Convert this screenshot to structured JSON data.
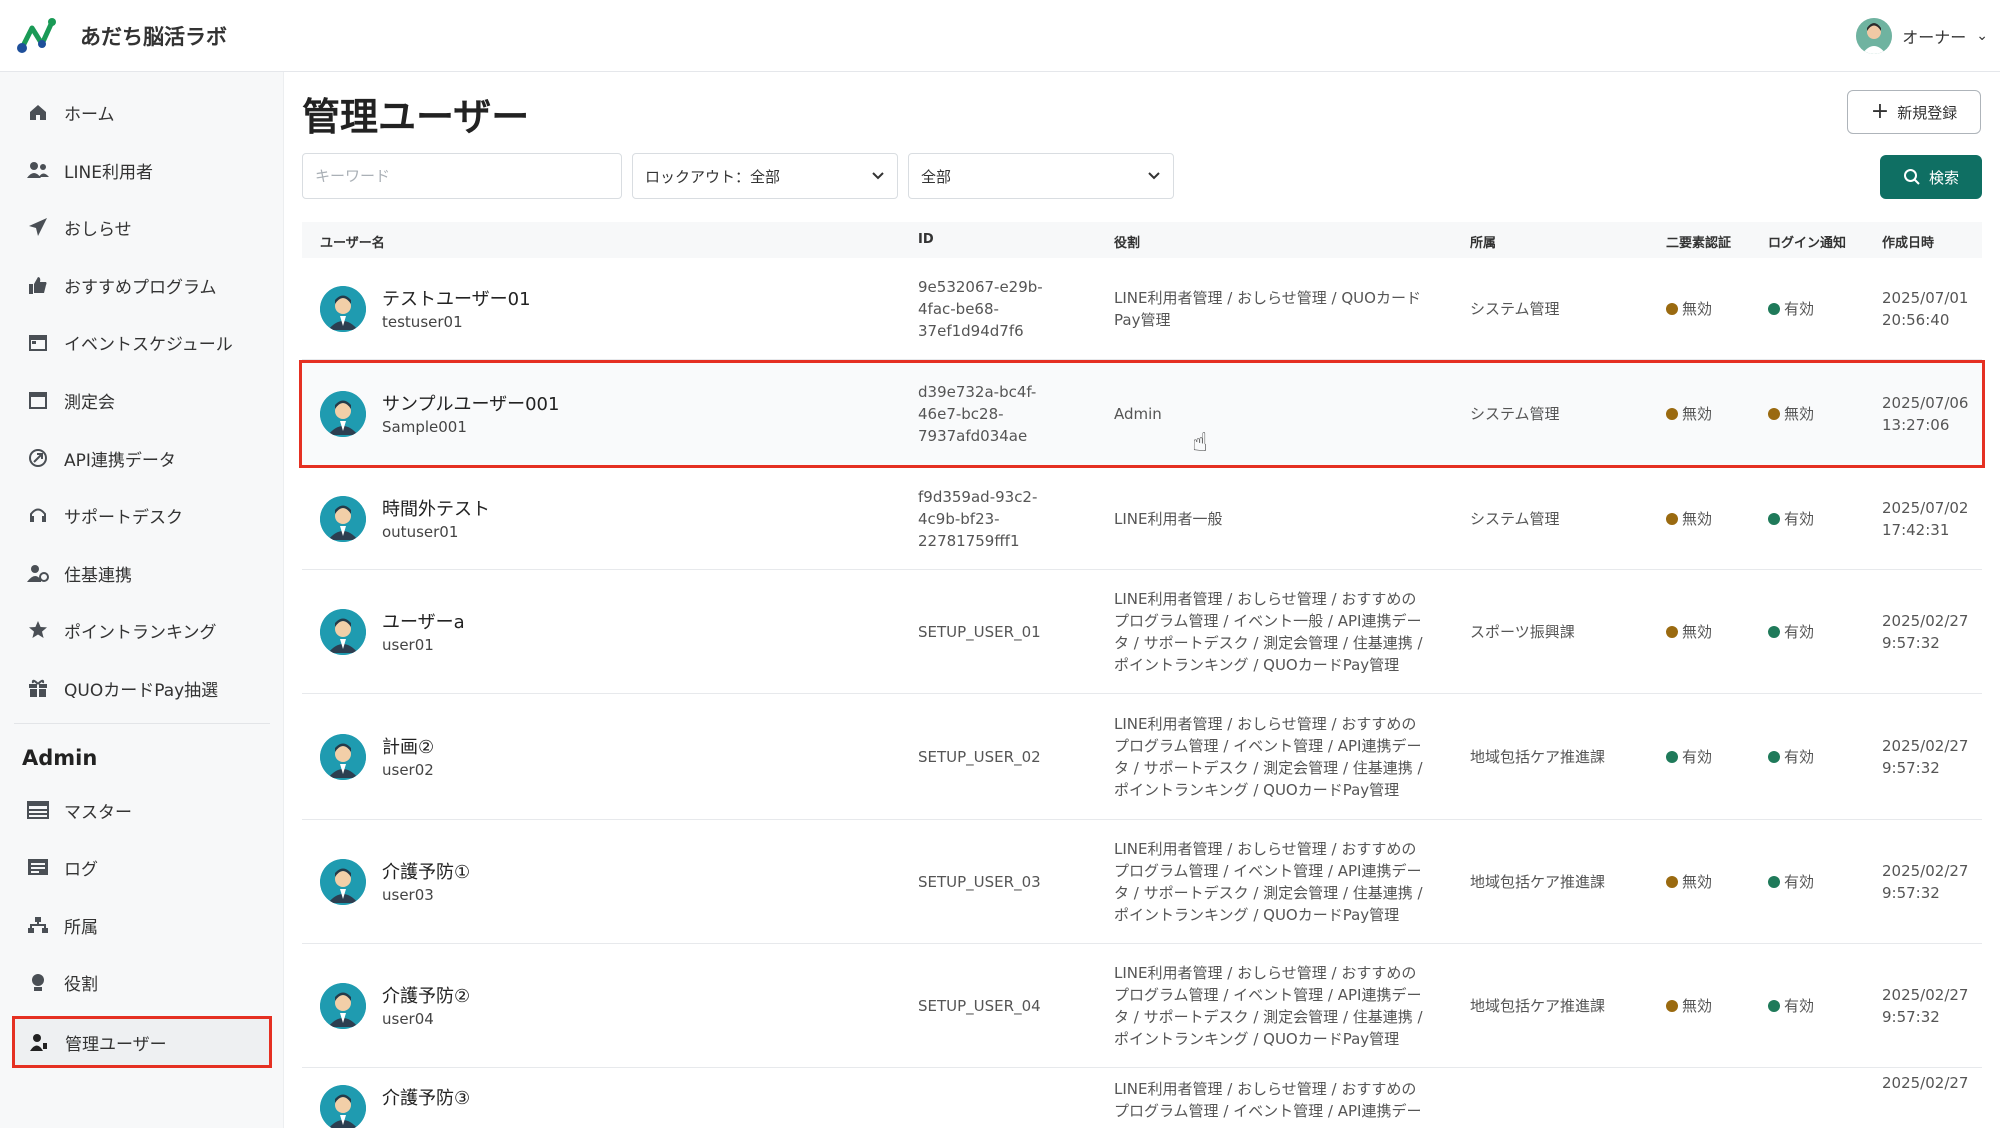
{
  "app": {
    "title": "あだち脳活ラボ",
    "user_name": "オーナー"
  },
  "sidebar": {
    "items": [
      {
        "label": "ホーム",
        "icon": "home-icon"
      },
      {
        "label": "LINE利用者",
        "icon": "users-icon"
      },
      {
        "label": "おしらせ",
        "icon": "paper-plane-icon"
      },
      {
        "label": "おすすめプログラム",
        "icon": "thumbs-up-icon"
      },
      {
        "label": "イベントスケジュール",
        "icon": "calendar-icon"
      },
      {
        "label": "測定会",
        "icon": "calendar-blank-icon"
      },
      {
        "label": "API連携データ",
        "icon": "api-icon"
      },
      {
        "label": "サポートデスク",
        "icon": "headset-icon"
      },
      {
        "label": "住基連携",
        "icon": "user-gear-icon"
      },
      {
        "label": "ポイントランキング",
        "icon": "star-icon"
      },
      {
        "label": "QUOカードPay抽選",
        "icon": "gift-icon"
      }
    ],
    "admin_section": "Admin",
    "admin_items": [
      {
        "label": "マスター",
        "icon": "table-icon"
      },
      {
        "label": "ログ",
        "icon": "log-icon"
      },
      {
        "label": "所属",
        "icon": "org-chart-icon"
      },
      {
        "label": "役割",
        "icon": "role-icon"
      },
      {
        "label": "管理ユーザー",
        "icon": "admin-user-icon"
      }
    ]
  },
  "page": {
    "title": "管理ユーザー",
    "new_button": "新規登録"
  },
  "filters": {
    "keyword_placeholder": "キーワード",
    "lockout_value": "ロックアウト：全部",
    "scope_value": "全部",
    "search_button": "検索"
  },
  "table": {
    "headers": {
      "username": "ユーザー名",
      "id": "ID",
      "role": "役割",
      "department": "所属",
      "two_factor": "二要素認証",
      "login_notify": "ログイン通知",
      "created": "作成日時"
    },
    "rows": [
      {
        "name": "テストユーザー01",
        "login": "testuser01",
        "id": [
          "9e532067-e29b-",
          "4fac-be68-",
          "37ef1d94d7f6"
        ],
        "role": [
          "LINE利用者管理 / おしらせ管理 / QUOカード",
          "Pay管理"
        ],
        "department": "システム管理",
        "two_factor": "無効",
        "login_notify": "有効",
        "created": [
          "2025/07/01",
          "20:56:40"
        ]
      },
      {
        "name": "サンプルユーザー001",
        "login": "Sample001",
        "id": [
          "d39e732a-bc4f-",
          "46e7-bc28-",
          "7937afd034ae"
        ],
        "role": [
          "Admin"
        ],
        "department": "システム管理",
        "two_factor": "無効",
        "login_notify": "無効",
        "created": [
          "2025/07/06",
          "13:27:06"
        ]
      },
      {
        "name": "時間外テスト",
        "login": "outuser01",
        "id": [
          "f9d359ad-93c2-",
          "4c9b-bf23-",
          "22781759fff1"
        ],
        "role": [
          "LINE利用者一般"
        ],
        "department": "システム管理",
        "two_factor": "無効",
        "login_notify": "有効",
        "created": [
          "2025/07/02",
          "17:42:31"
        ]
      },
      {
        "name": "ユーザーa",
        "login": "user01",
        "id": [
          "SETUP_USER_01"
        ],
        "role": [
          "LINE利用者管理 / おしらせ管理 / おすすめの",
          "プログラム管理 / イベント一般 / API連携デー",
          "タ / サポートデスク / 測定会管理 / 住基連携 /",
          "ポイントランキング / QUOカードPay管理"
        ],
        "department": "スポーツ振興課",
        "two_factor": "無効",
        "login_notify": "有効",
        "created": [
          "2025/02/27",
          "9:57:32"
        ]
      },
      {
        "name": "計画②",
        "login": "user02",
        "id": [
          "SETUP_USER_02"
        ],
        "role": [
          "LINE利用者管理 / おしらせ管理 / おすすめの",
          "プログラム管理 / イベント管理 / API連携デー",
          "タ / サポートデスク / 測定会管理 / 住基連携 /",
          "ポイントランキング / QUOカードPay管理"
        ],
        "department": "地域包括ケア推進課",
        "two_factor": "有効",
        "login_notify": "有効",
        "created": [
          "2025/02/27",
          "9:57:32"
        ]
      },
      {
        "name": "介護予防①",
        "login": "user03",
        "id": [
          "SETUP_USER_03"
        ],
        "role": [
          "LINE利用者管理 / おしらせ管理 / おすすめの",
          "プログラム管理 / イベント管理 / API連携デー",
          "タ / サポートデスク / 測定会管理 / 住基連携 /",
          "ポイントランキング / QUOカードPay管理"
        ],
        "department": "地域包括ケア推進課",
        "two_factor": "無効",
        "login_notify": "有効",
        "created": [
          "2025/02/27",
          "9:57:32"
        ]
      },
      {
        "name": "介護予防②",
        "login": "user04",
        "id": [
          "SETUP_USER_04"
        ],
        "role": [
          "LINE利用者管理 / おしらせ管理 / おすすめの",
          "プログラム管理 / イベント管理 / API連携デー",
          "タ / サポートデスク / 測定会管理 / 住基連携 /",
          "ポイントランキング / QUOカードPay管理"
        ],
        "department": "地域包括ケア推進課",
        "two_factor": "無効",
        "login_notify": "有効",
        "created": [
          "2025/02/27",
          "9:57:32"
        ]
      },
      {
        "name": "介護予防③",
        "login": "",
        "id": [
          ""
        ],
        "role": [
          "LINE利用者管理 / おしらせ管理 / おすすめの",
          "プログラム管理 / イベント管理 / API連携デー"
        ],
        "department": "",
        "two_factor": "",
        "login_notify": "",
        "created": [
          "2025/02/27"
        ]
      }
    ]
  },
  "colors": {
    "accent": "#0f6f63",
    "enabled": "#1f7a5a",
    "disabled": "#9a6a10",
    "highlight": "#e53022"
  }
}
